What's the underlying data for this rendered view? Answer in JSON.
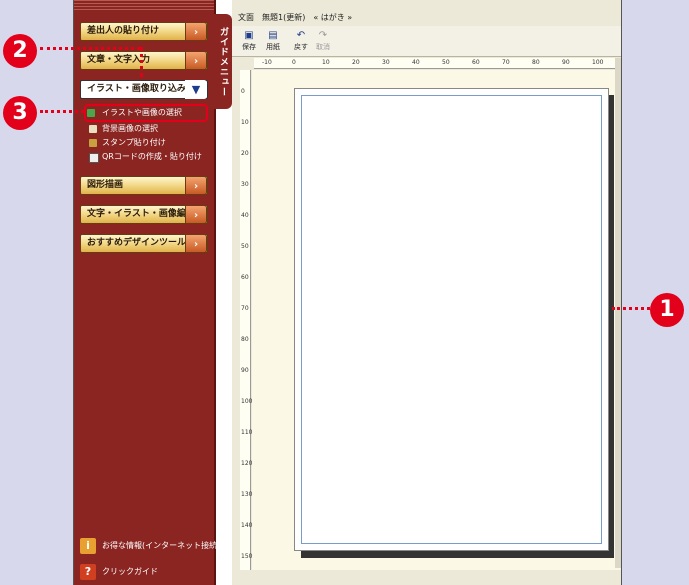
{
  "sidebar": {
    "guide_tab": "ガイドメニュー",
    "menu": [
      {
        "label": "差出人の貼り付け"
      },
      {
        "label": "文章・文字入力"
      },
      {
        "label": "イラスト・画像取り込み"
      },
      {
        "label": "図形描画"
      },
      {
        "label": "文字・イラスト・画像編集"
      },
      {
        "label": "おすすめデザインツール"
      }
    ],
    "submenu": [
      {
        "label": "イラストや画像の選択"
      },
      {
        "label": "背景画像の選択"
      },
      {
        "label": "スタンプ貼り付け"
      },
      {
        "label": "QRコードの作成・貼り付け"
      }
    ],
    "bottom": [
      {
        "label": "お得な情報(インターネット接続)",
        "badge": "i"
      },
      {
        "label": "クリックガイド",
        "badge": "?"
      }
    ]
  },
  "app": {
    "title": "文面　無題1(更新)　« はがき »",
    "toolbar": [
      {
        "label": "保存",
        "icon": "save-icon"
      },
      {
        "label": "用紙",
        "icon": "paper-icon"
      },
      {
        "label": "戻す",
        "icon": "undo-icon"
      },
      {
        "label": "取消",
        "icon": "redo-icon"
      }
    ],
    "hruler_ticks": [
      "-10",
      "0",
      "10",
      "20",
      "30",
      "40",
      "50",
      "60",
      "70",
      "80",
      "90",
      "100"
    ],
    "vruler_ticks": [
      "0",
      "10",
      "20",
      "30",
      "40",
      "50",
      "60",
      "70",
      "80",
      "90",
      "100",
      "110",
      "120",
      "130",
      "140",
      "150"
    ]
  },
  "callouts": [
    "1",
    "2",
    "3"
  ],
  "colors": {
    "callout": "#e2001a",
    "sidebar": "#8a2522",
    "accent": "#1e3c8c"
  }
}
